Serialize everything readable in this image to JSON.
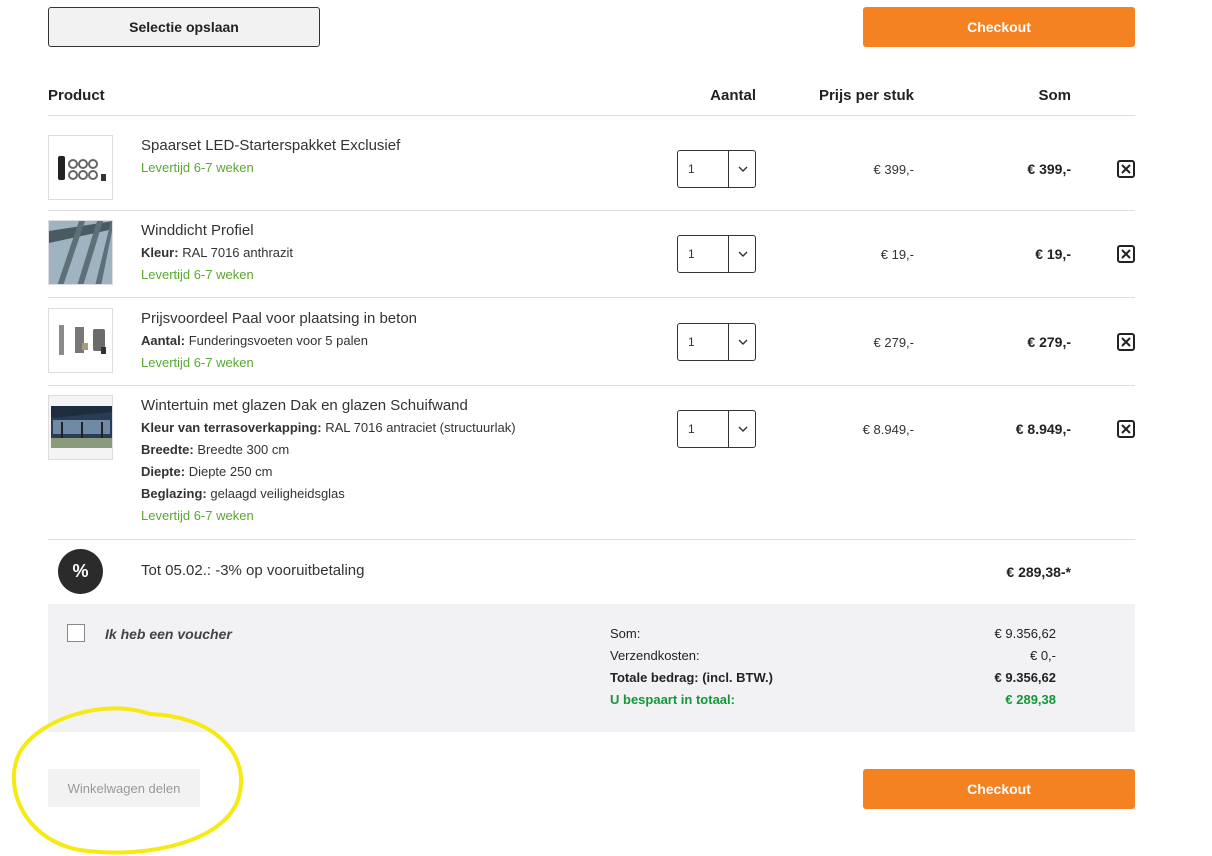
{
  "actions": {
    "save_label": "Selectie opslaan",
    "checkout_label": "Checkout",
    "share_label": "Winkelwagen delen"
  },
  "table": {
    "headers": {
      "product": "Product",
      "aantal": "Aantal",
      "prijs": "Prijs per stuk",
      "som": "Som"
    }
  },
  "items": [
    {
      "name": "Spaarset LED-Starterspakket Exclusief",
      "delivery": "Levertijd 6-7 weken",
      "qty": "1",
      "unit_price": "€ 399,-",
      "sum": "€ 399,-",
      "attributes": []
    },
    {
      "name": "Winddicht Profiel",
      "delivery": "Levertijd 6-7 weken",
      "qty": "1",
      "unit_price": "€ 19,-",
      "sum": "€ 19,-",
      "attributes": [
        {
          "label": "Kleur:",
          "value": "RAL 7016 anthrazit"
        }
      ]
    },
    {
      "name": "Prijsvoordeel Paal voor plaatsing in beton",
      "delivery": "Levertijd 6-7 weken",
      "qty": "1",
      "unit_price": "€ 279,-",
      "sum": "€ 279,-",
      "attributes": [
        {
          "label": "Aantal:",
          "value": "Funderingsvoeten voor 5 palen"
        }
      ]
    },
    {
      "name": "Wintertuin met glazen Dak en glazen Schuifwand",
      "delivery": "Levertijd 6-7 weken",
      "qty": "1",
      "unit_price": "€ 8.949,-",
      "sum": "€ 8.949,-",
      "attributes": [
        {
          "label": "Kleur van terrasoverkapping:",
          "value": "RAL 7016 antraciet (structuurlak)"
        },
        {
          "label": "Breedte:",
          "value": "Breedte 300 cm"
        },
        {
          "label": "Diepte:",
          "value": "Diepte 250 cm"
        },
        {
          "label": "Beglazing:",
          "value": "gelaagd veiligheidsglas"
        }
      ]
    }
  ],
  "discount": {
    "icon": "%",
    "text": "Tot 05.02.: -3% op vooruitbetaling",
    "amount": "€ 289,38-*"
  },
  "summary": {
    "voucher_label": "Ik heb een voucher",
    "subtotal_label": "Som:",
    "subtotal": "€ 9.356,62",
    "shipping_label": "Verzendkosten:",
    "shipping": "€ 0,-",
    "total_label": "Totale bedrag: (incl. BTW.)",
    "total": "€ 9.356,62",
    "savings_label": "U bespaart in totaal:",
    "savings": "€ 289,38"
  },
  "colors": {
    "accent": "#f58220",
    "delivery_green": "#5aa832",
    "savings_green": "#15963a",
    "highlight": "#f5ea14"
  }
}
